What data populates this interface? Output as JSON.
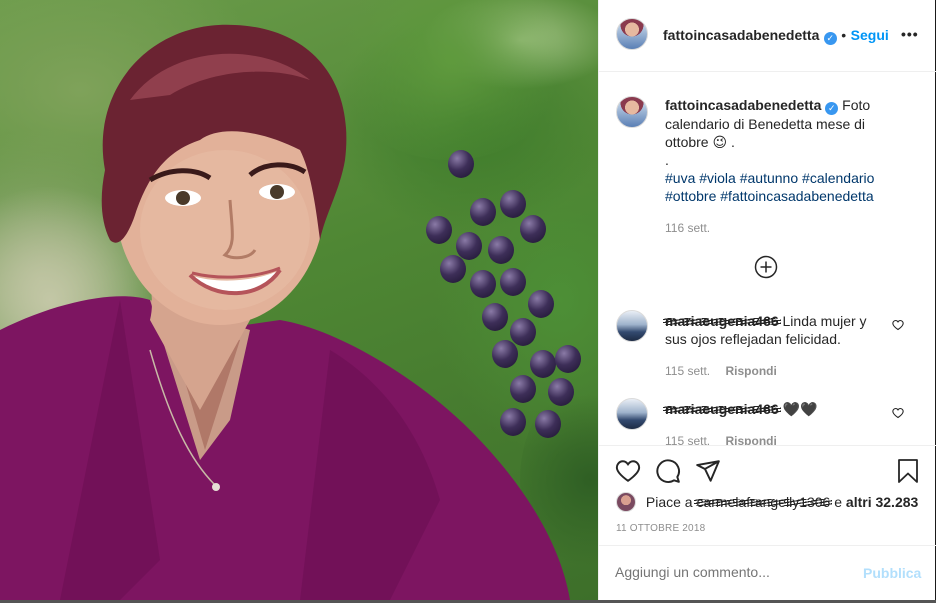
{
  "post": {
    "username": "fattoincasadabenedetta",
    "follow_label": "Segui",
    "more_label": "•••",
    "caption_line1": "Foto calendario di Benedetta mese di ottobre 😉 .",
    "caption_dot": ".",
    "hashtags": [
      "#uva",
      "#viola",
      "#autunno",
      "#calendario",
      "#ottobre",
      "#fattoincasadabenedetta"
    ],
    "caption_time": "116 sett."
  },
  "comments": [
    {
      "username": "mariaeugenia466",
      "text": "Linda mujer y sus ojos reflejadan felicidad.",
      "time": "115 sett.",
      "reply_label": "Rispondi"
    },
    {
      "username": "mariaeugenia466",
      "text": "🖤🖤",
      "time": "115 sett.",
      "reply_label": "Rispondi"
    }
  ],
  "likes": {
    "prefix": "Piace a",
    "user": "carmelafrangelly1306",
    "middle": "e",
    "others": "altri 32.283"
  },
  "date": "11 OTTOBRE 2018",
  "composer": {
    "placeholder": "Aggiungi un commento...",
    "publish_label": "Pubblica"
  },
  "colors": {
    "accent": "#0095f6",
    "verified": "#3897f0",
    "hashtag": "#00376b",
    "publish_disabled": "#b2dffc"
  },
  "icons": [
    "verified-icon",
    "more-icon",
    "load-more-icon",
    "heart-icon",
    "comment-icon",
    "share-icon",
    "save-icon"
  ]
}
